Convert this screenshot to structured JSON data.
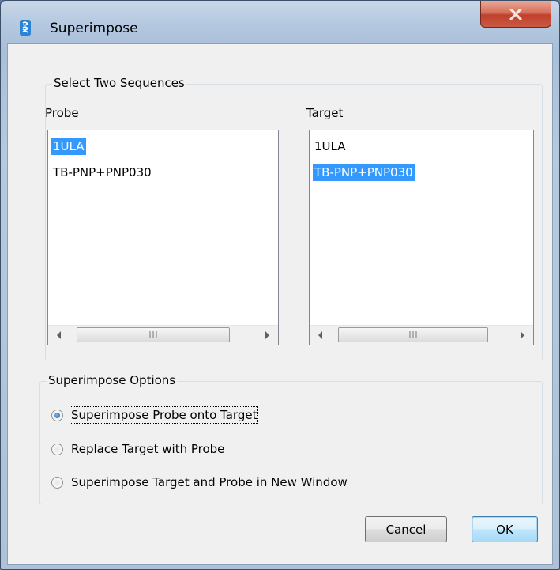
{
  "window": {
    "title": "Superimpose"
  },
  "select_group": {
    "legend": "Select Two Sequences",
    "probe": {
      "label": "Probe",
      "items": [
        "1ULA",
        "TB-PNP+PNP030"
      ],
      "selected_index": 0
    },
    "target": {
      "label": "Target",
      "items": [
        "1ULA",
        "TB-PNP+PNP030"
      ],
      "selected_index": 1
    },
    "scroll_grip": "III"
  },
  "options_group": {
    "legend": "Superimpose Options",
    "options": [
      "Superimpose Probe onto Target",
      "Replace Target with Probe",
      "Superimpose Target and Probe in New Window"
    ],
    "selected_index": 0
  },
  "buttons": {
    "cancel": "Cancel",
    "ok": "OK"
  },
  "colors": {
    "selection": "#3399ff",
    "close_button": "#c0402b"
  }
}
